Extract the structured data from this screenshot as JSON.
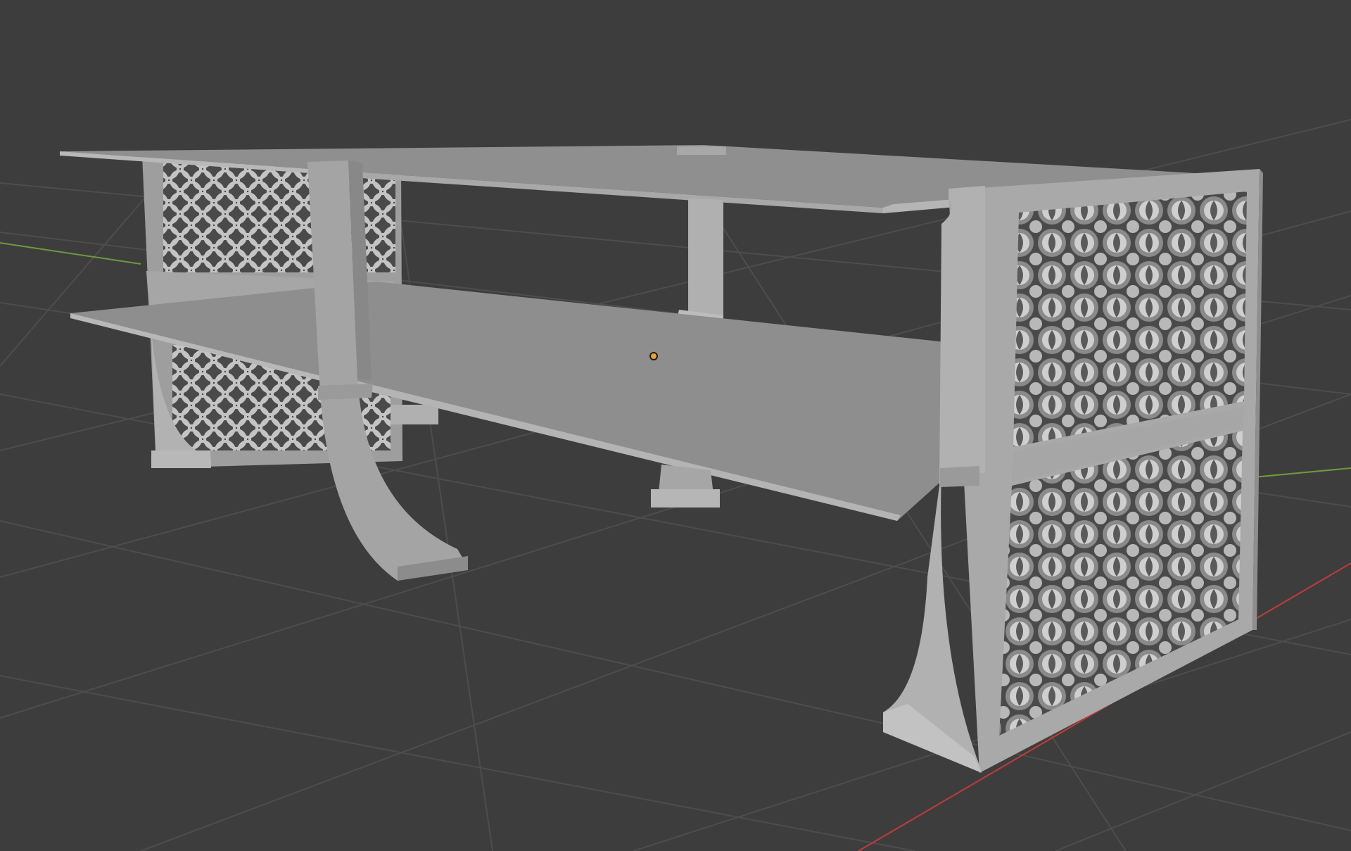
{
  "viewport": {
    "name": "3D Viewport",
    "background": "#3d3d3d",
    "grid_color": "#4d4d4d",
    "axis_x_color": "#c13b3b",
    "axis_y_color": "#6e9a3a",
    "origin_color": "#f0a030"
  },
  "scene": {
    "object": "tv-stand-mesh",
    "material_color": "#a2a2a2",
    "shelf_count": 2,
    "side_panel_count": 2,
    "pattern": "interlocking-circles-lattice"
  }
}
